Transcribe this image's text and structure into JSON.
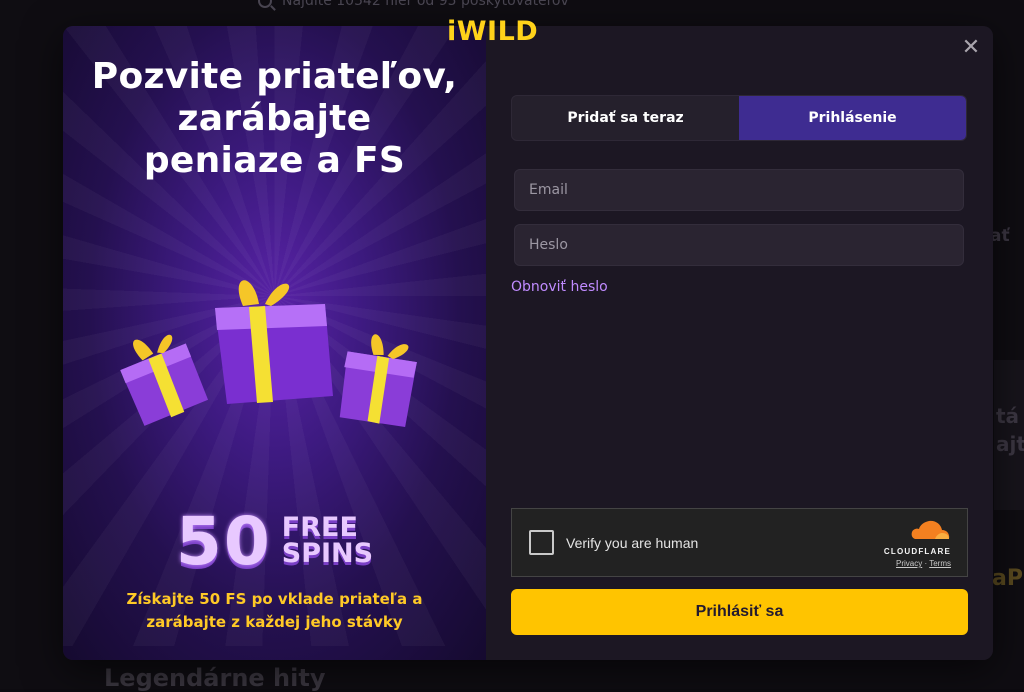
{
  "background": {
    "search_text": "Nájdite 10542 hier od 95 poskytovateľov",
    "heading": "Legendárne hity",
    "right_fragments": [
      "ať",
      "tá",
      "ajte",
      "aPo"
    ]
  },
  "promo": {
    "title_lines": [
      "Pozvite priateľov,",
      "zarábajte",
      "peniaze a FS"
    ],
    "spins_number": "50",
    "spins_word_1": "FREE",
    "spins_word_2": "SPINS",
    "subtitle_lines": [
      "Získajte 50 FS po vklade priateľa a",
      "zarábajte z každej jeho stávky"
    ]
  },
  "brand": {
    "logo": "iWILD",
    "color": "#ffd21a"
  },
  "close_icon": "close-icon",
  "tabs": [
    {
      "label": "Pridať sa teraz",
      "active": false
    },
    {
      "label": "Prihlásenie",
      "active": true
    }
  ],
  "form": {
    "email_placeholder": "Email",
    "password_placeholder": "Heslo",
    "forgot_label": "Obnoviť heslo",
    "submit_label": "Prihlásiť sa"
  },
  "captcha": {
    "label": "Verify you are human",
    "brand": "CLOUDFLARE",
    "privacy": "Privacy",
    "separator": "·",
    "terms": "Terms"
  },
  "colors": {
    "accent": "#ffc400",
    "tab_active": "#3e2c91",
    "link": "#c08bff",
    "promo_text": "#ffc926"
  }
}
